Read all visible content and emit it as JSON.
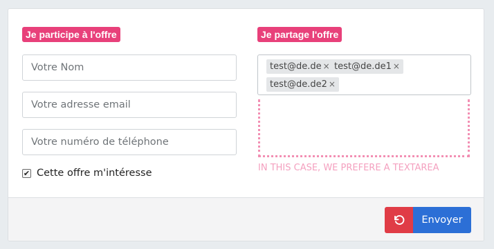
{
  "left_section": {
    "badge": "Je participe à l'offre",
    "name_placeholder": "Votre Nom",
    "email_placeholder": "Votre adresse email",
    "phone_placeholder": "Votre numéro de téléphone",
    "checkbox_label": "Cette offre m'intéresse",
    "checkbox_checked": true
  },
  "right_section": {
    "badge": "Je partage l'offre",
    "tags": [
      {
        "label": "test@de.de",
        "remove": "×"
      },
      {
        "label": "test@de.de1",
        "remove": "×"
      },
      {
        "label": "test@de.de2",
        "remove": "×"
      }
    ],
    "note": "IN THIS CASE, WE PREFERE A TEXTAREA"
  },
  "footer": {
    "send_label": "Envoyer",
    "reset_icon": "undo-icon"
  },
  "colors": {
    "badge": "#e8407a",
    "reset_button": "#e03c46",
    "send_button": "#2c6fd6",
    "note": "#f4a0bf"
  }
}
